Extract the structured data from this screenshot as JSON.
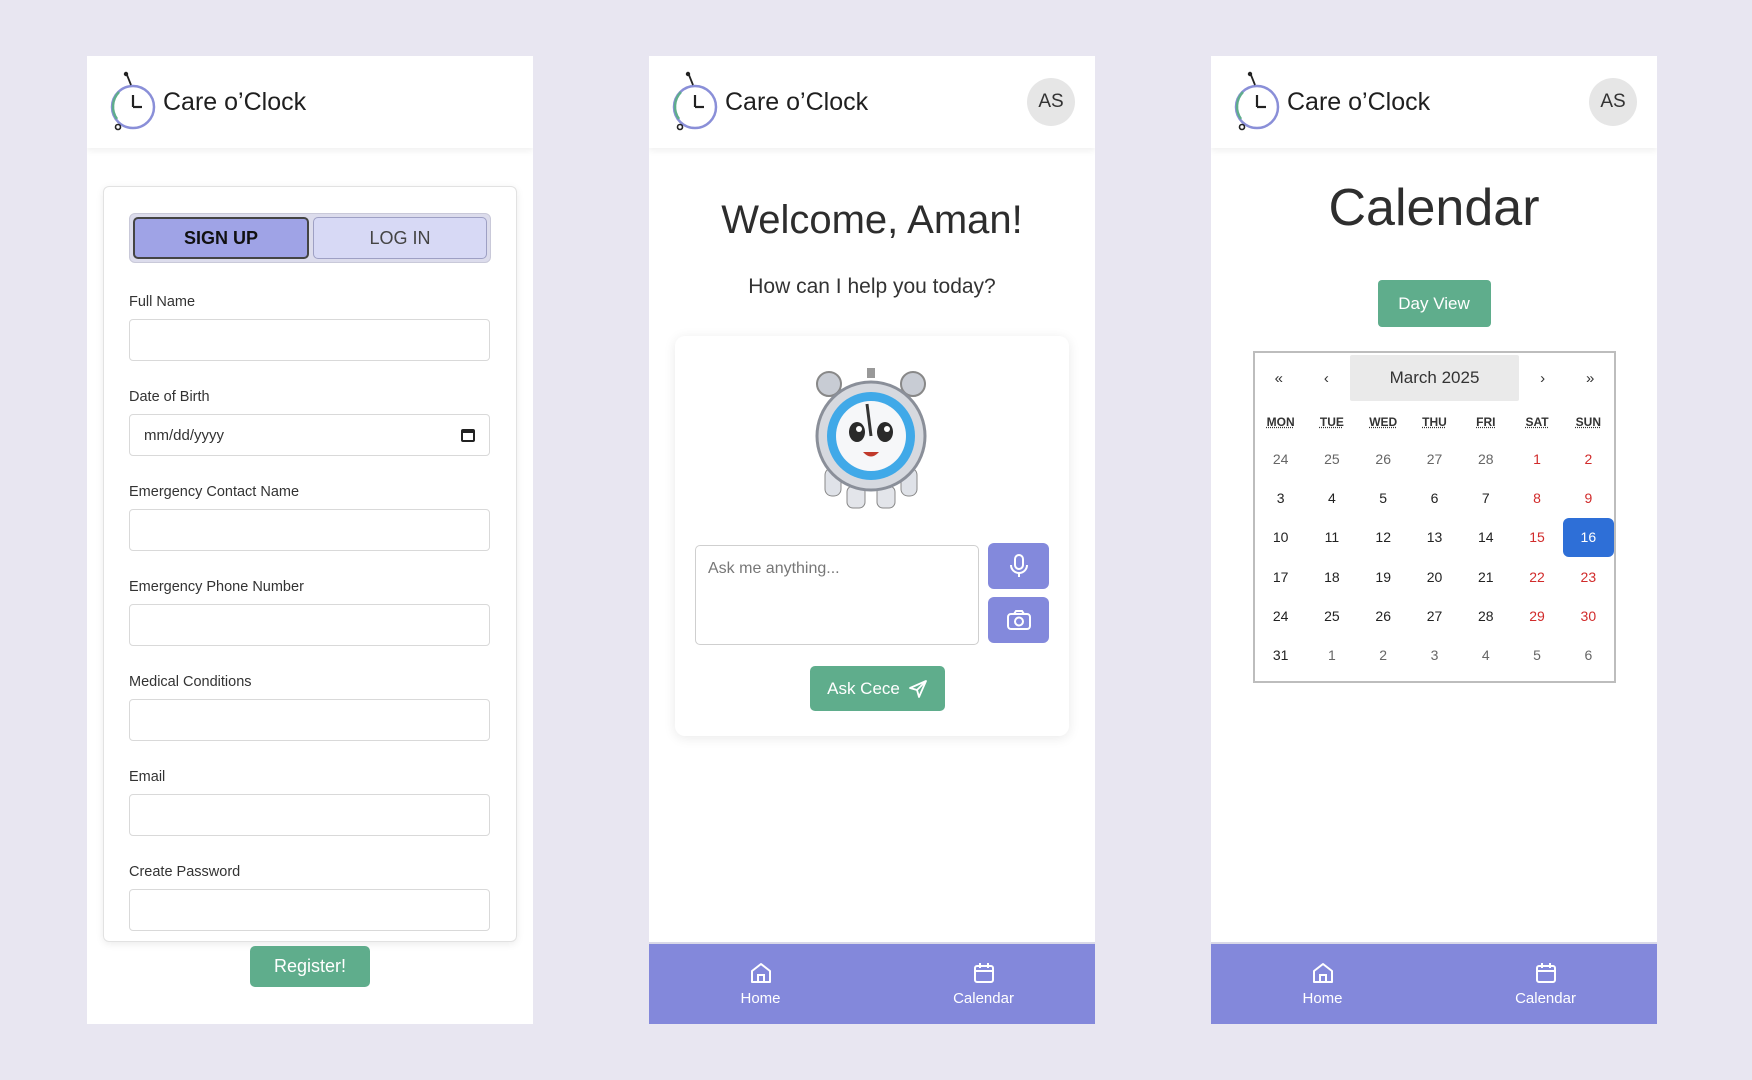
{
  "brand": {
    "name": "Care o’Clock"
  },
  "user": {
    "initials": "AS"
  },
  "signup": {
    "tabs": {
      "signup": "SIGN UP",
      "login": "LOG IN"
    },
    "fields": {
      "full_name": "Full Name",
      "dob": "Date of Birth",
      "dob_placeholder": "mm/dd/yyyy",
      "emergency_name": "Emergency Contact Name",
      "emergency_phone": "Emergency Phone Number",
      "medical": "Medical Conditions",
      "email": "Email",
      "password": "Create Password"
    },
    "register_label": "Register!"
  },
  "home": {
    "welcome": "Welcome, Aman!",
    "subtitle": "How can I help you today?",
    "ask_placeholder": "Ask me anything...",
    "ask_button": "Ask Cece"
  },
  "nav": {
    "home": "Home",
    "calendar": "Calendar"
  },
  "calendar": {
    "title": "Calendar",
    "day_view": "Day View",
    "nav": {
      "first": "«",
      "prev": "‹",
      "next": "›",
      "last": "»"
    },
    "month": "March 2025",
    "weekdays": [
      "MON",
      "TUE",
      "WED",
      "THU",
      "FRI",
      "SAT",
      "SUN"
    ],
    "weeks": [
      [
        "24",
        "25",
        "26",
        "27",
        "28",
        "1",
        "2"
      ],
      [
        "3",
        "4",
        "5",
        "6",
        "7",
        "8",
        "9"
      ],
      [
        "10",
        "11",
        "12",
        "13",
        "14",
        "15",
        "16"
      ],
      [
        "17",
        "18",
        "19",
        "20",
        "21",
        "22",
        "23"
      ],
      [
        "24",
        "25",
        "26",
        "27",
        "28",
        "29",
        "30"
      ],
      [
        "31",
        "1",
        "2",
        "3",
        "4",
        "5",
        "6"
      ]
    ],
    "selected_day": "16"
  },
  "colors": {
    "accent_purple": "#8388db",
    "accent_green": "#5fad8c",
    "selected_blue": "#2e6fd7",
    "weekend_red": "#d12b2b"
  }
}
